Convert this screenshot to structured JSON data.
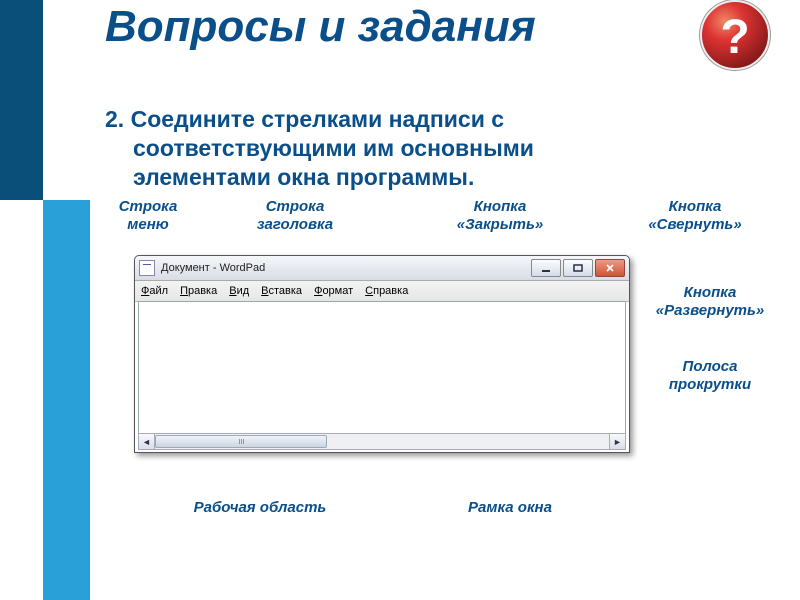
{
  "title": "Вопросы и задания",
  "badge_symbol": "?",
  "question_prefix": "2.",
  "question_line1": "Соедините стрелками надписи с",
  "question_line2": "соответствующими им основными",
  "question_line3": "элементами окна программы.",
  "labels": {
    "menu_line": "Строка меню",
    "title_line": "Строка заголовка",
    "close_btn": "Кнопка «Закрыть»",
    "minimize_btn": "Кнопка «Свернуть»",
    "maximize_btn": "Кнопка «Развернуть»",
    "scrollbar": "Полоса прокрутки",
    "workarea": "Рабочая область",
    "frame": "Рамка окна"
  },
  "window": {
    "title": "Документ - WordPad",
    "menus": [
      "Файл",
      "Правка",
      "Вид",
      "Вставка",
      "Формат",
      "Справка"
    ]
  }
}
